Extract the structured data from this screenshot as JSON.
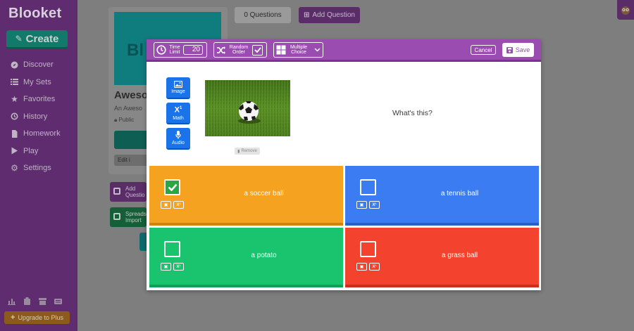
{
  "sidebar": {
    "logo": "Blooket",
    "create_label": "Create",
    "items": [
      {
        "label": "Discover",
        "icon": "compass-icon"
      },
      {
        "label": "My Sets",
        "icon": "list-icon"
      },
      {
        "label": "Favorites",
        "icon": "star-icon"
      },
      {
        "label": "History",
        "icon": "history-icon"
      },
      {
        "label": "Homework",
        "icon": "document-icon"
      },
      {
        "label": "Play",
        "icon": "play-icon"
      },
      {
        "label": "Settings",
        "icon": "gear-icon"
      }
    ],
    "upgrade_label": "Upgrade to Plus"
  },
  "background_page": {
    "cover_letters": "Bl",
    "set_title": "Aweso",
    "set_description": "An Aweso",
    "visibility": "Public",
    "edit_label": "Edit i",
    "question_count": "0 Questions",
    "add_question_label": "Add Question",
    "add_question_side": "Add Questio",
    "spreadsheet_import": "Spreads Import"
  },
  "modal": {
    "toolbar": {
      "time_limit_label": "Time Limit",
      "time_limit_value": "20",
      "random_order_label": "Random Order",
      "random_order_checked": true,
      "question_type_label": "Multiple Choice",
      "cancel_label": "Cancel",
      "save_label": "Save"
    },
    "media": {
      "image_label": "Image",
      "math_label": "Math",
      "audio_label": "Audio",
      "remove_label": "Remove"
    },
    "question": "What's this?",
    "answers": [
      {
        "text": "a soccer ball",
        "correct": true,
        "color": "#f5a221"
      },
      {
        "text": "a tennis ball",
        "correct": false,
        "color": "#3b7cf2"
      },
      {
        "text": "a potato",
        "correct": false,
        "color": "#1ac46e"
      },
      {
        "text": "a grass ball",
        "correct": false,
        "color": "#f3432f"
      }
    ]
  },
  "colors": {
    "sidebar_bg": "#5e2c6f",
    "modal_header": "#9a4cb0",
    "media_button": "#1a73e8"
  }
}
